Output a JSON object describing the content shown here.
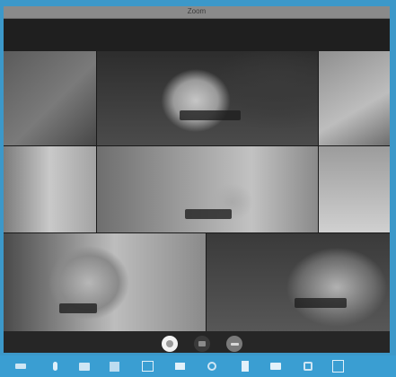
{
  "window": {
    "title": "Zoom"
  },
  "participants": [
    {
      "name": ""
    },
    {
      "name": ""
    },
    {
      "name": ""
    },
    {
      "name": ""
    },
    {
      "name": ""
    },
    {
      "name": ""
    },
    {
      "name": ""
    },
    {
      "name": ""
    },
    {
      "name": ""
    },
    {
      "name": ""
    }
  ],
  "controls": [
    {
      "icon": "record-icon"
    },
    {
      "icon": "camera-icon"
    },
    {
      "icon": "end-call-icon"
    }
  ],
  "taskbar_icons": [
    "start-icon",
    "mic-icon",
    "folder-icon",
    "app-icon",
    "terminal-icon",
    "mail-icon",
    "settings-icon",
    "document-icon",
    "video-icon",
    "copy-icon",
    "notes-icon"
  ]
}
